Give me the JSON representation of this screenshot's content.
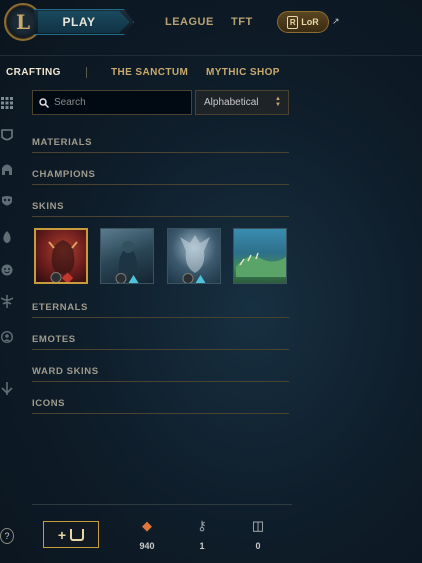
{
  "topbar": {
    "logo_letter": "L",
    "play_label": "PLAY",
    "links": [
      "LEAGUE",
      "TFT"
    ],
    "lor_label": "LoR",
    "lor_badge": "R",
    "external_icon": "↗"
  },
  "subnav": {
    "items": [
      {
        "label": "CRAFTING",
        "active": true
      },
      {
        "label": "THE SANCTUM",
        "active": false
      },
      {
        "label": "MYTHIC SHOP",
        "active": false
      }
    ]
  },
  "sidebar": {
    "icons": [
      "grid-icon",
      "shield-icon",
      "helmet-icon",
      "mask-icon",
      "flame-icon",
      "emote-icon",
      "ward-icon",
      "profile-icon",
      "arrow-icon"
    ]
  },
  "filters": {
    "search_placeholder": "Search",
    "sort_value": "Alphabetical"
  },
  "sections": [
    {
      "label": "MATERIALS"
    },
    {
      "label": "CHAMPIONS"
    },
    {
      "label": "SKINS"
    },
    {
      "label": "ETERNALS"
    },
    {
      "label": "EMOTES"
    },
    {
      "label": "WARD SKINS"
    },
    {
      "label": "ICONS"
    }
  ],
  "skins": [
    {
      "name": "skin-1",
      "selected": true,
      "colors": [
        "#6b1d1d",
        "#b0412e"
      ],
      "badges": [
        "coin",
        "gem-red"
      ]
    },
    {
      "name": "skin-2",
      "selected": false,
      "colors": [
        "#1c3444",
        "#5b7c8e"
      ],
      "badges": [
        "coin",
        "gem-blue"
      ]
    },
    {
      "name": "skin-3",
      "selected": false,
      "colors": [
        "#1d3446",
        "#9fb7c8"
      ],
      "badges": [
        "coin",
        "gem-blue"
      ]
    },
    {
      "name": "skin-4",
      "selected": false,
      "colors": [
        "#2e6f8a",
        "#5aa46a"
      ],
      "badges": []
    }
  ],
  "footer": {
    "help": "?",
    "add_label": "+",
    "counters": [
      {
        "icon": "essence-icon",
        "glyph": "◆",
        "value": "940",
        "color": "#e0753a"
      },
      {
        "icon": "key-icon",
        "glyph": "⚷",
        "value": "1",
        "color": "#9aa0a6"
      },
      {
        "icon": "chest-icon",
        "glyph": "◫",
        "value": "0",
        "color": "#c9c9c9"
      }
    ]
  }
}
